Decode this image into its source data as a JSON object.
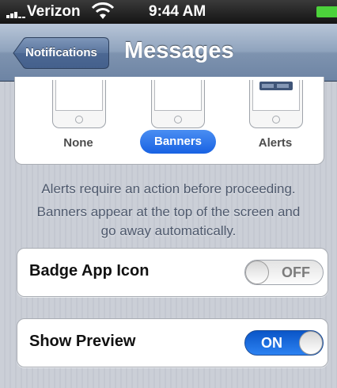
{
  "status_bar": {
    "carrier": "Verizon",
    "time": "9:44 AM",
    "signal_bars": 5,
    "battery_color": "#4cd23b"
  },
  "nav": {
    "back_label": "Notifications",
    "title": "Messages"
  },
  "alert_style": {
    "options": [
      {
        "label": "None",
        "selected": false
      },
      {
        "label": "Banners",
        "selected": true
      },
      {
        "label": "Alerts",
        "selected": false
      }
    ],
    "accent": "#1862e3"
  },
  "description": {
    "line1": "Alerts require an action before proceeding.",
    "line2": "Banners appear at the top of the screen and",
    "line3": "go away automatically."
  },
  "settings": [
    {
      "label": "Badge App Icon",
      "state_label": "OFF",
      "enabled": false
    },
    {
      "label": "Show Preview",
      "state_label": "ON",
      "enabled": true
    }
  ],
  "icons": [
    "signal-icon",
    "wifi-icon",
    "battery-icon",
    "back-chevron-icon",
    "phone-screen-icon",
    "home-button-icon"
  ]
}
